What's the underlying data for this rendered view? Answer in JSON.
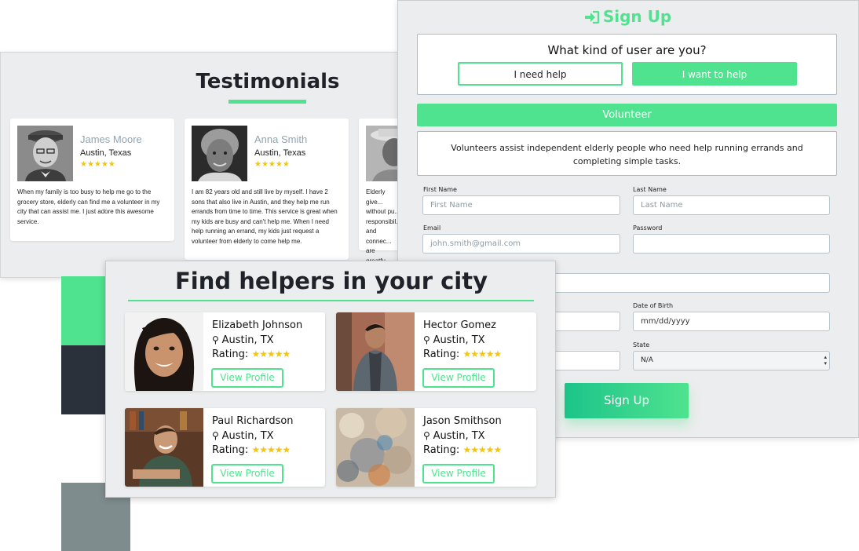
{
  "testimonials": {
    "title": "Testimonials",
    "items": [
      {
        "name": "James Moore",
        "location": "Austin, Texas",
        "stars": "★★★★★",
        "text": "When my family is too busy to help me go to the grocery store, elderly can find me a volunteer in my city that can assist me. I just adore this awesome service."
      },
      {
        "name": "Anna Smith",
        "location": "Austin, Texas",
        "stars": "★★★★★",
        "text": "I am 82 years old and still live by myself. I have 2 sons that also live in Austin, and they help me run errands from time to time. This service is great when my kids are busy and can't help me. When I need help running an errand, my kids just request a volunteer from elderly to come help me."
      },
      {
        "name": "",
        "location": "",
        "stars": "",
        "text": "Elderly give... without pu... responsibil... and connec... are greatfu..."
      }
    ]
  },
  "signup": {
    "title": "Sign Up",
    "question": "What kind of user are you?",
    "need_help_label": "I need help",
    "want_help_label": "I want to help",
    "role_banner": "Volunteer",
    "description": "Volunteers assist independent elderly people who need help running errands and completing simple tasks.",
    "fields": {
      "first_name_label": "First Name",
      "first_name_placeholder": "First Name",
      "last_name_label": "Last Name",
      "last_name_placeholder": "Last Name",
      "email_label": "Email",
      "email_placeholder": "john.smith@gmail.com",
      "password_label": "Password",
      "dob_label": "Date of Birth",
      "dob_placeholder": "mm/dd/yyyy",
      "state_label": "State",
      "state_value": "N/A"
    },
    "submit_label": "Sign Up"
  },
  "helpers": {
    "title": "Find helpers in your city",
    "rating_label": "Rating:",
    "stars": "★★★★★",
    "rating_value": 4.5,
    "view_profile_label": "View Profile",
    "items": [
      {
        "name": "Elizabeth Johnson",
        "location": "Austin, TX"
      },
      {
        "name": "Hector Gomez",
        "location": "Austin, TX"
      },
      {
        "name": "Paul Richardson",
        "location": "Austin, TX"
      },
      {
        "name": "Jason Smithson",
        "location": "Austin, TX"
      }
    ]
  },
  "colors": {
    "accent": "#4fe38f",
    "star": "#f0c419",
    "panel": "#ecedee",
    "dark": "#1f2228"
  },
  "icons": [
    "sign-in-icon",
    "map-marker-icon",
    "star-icon",
    "select-arrows-icon"
  ]
}
